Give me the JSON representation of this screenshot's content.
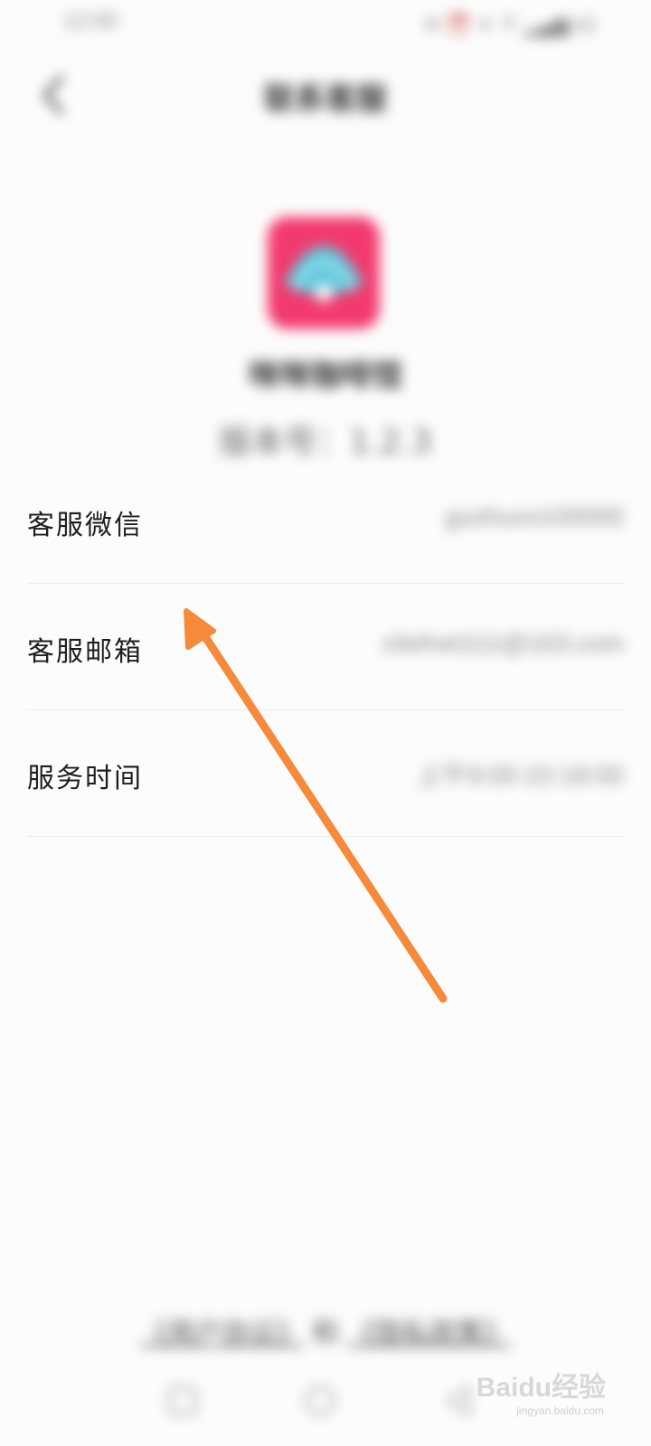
{
  "status_bar": {
    "time": "12:00",
    "icons": "✉ ⏰ ✦ 〒 ▂▄▆ 62"
  },
  "navbar": {
    "title": "联系客服"
  },
  "app": {
    "name": "咪咪咖啡馆",
    "version": "版本号：1.2.3",
    "icon_color": "#f23a6e"
  },
  "info": [
    {
      "label": "客服微信",
      "value": "gushuxs100000"
    },
    {
      "label": "客服邮箱",
      "value": "cliefnet111@163.com"
    },
    {
      "label": "服务时间",
      "value": "上午9:00-22:18:00"
    }
  ],
  "footer": {
    "user_agreement": "《用户协议》",
    "separator": " 和 ",
    "privacy_policy": "《隐私政策》"
  },
  "annotation": {
    "arrow_color": "#f58a3a"
  },
  "watermark": {
    "brand": "Baidu经验",
    "url": "jingyan.baidu.com"
  }
}
